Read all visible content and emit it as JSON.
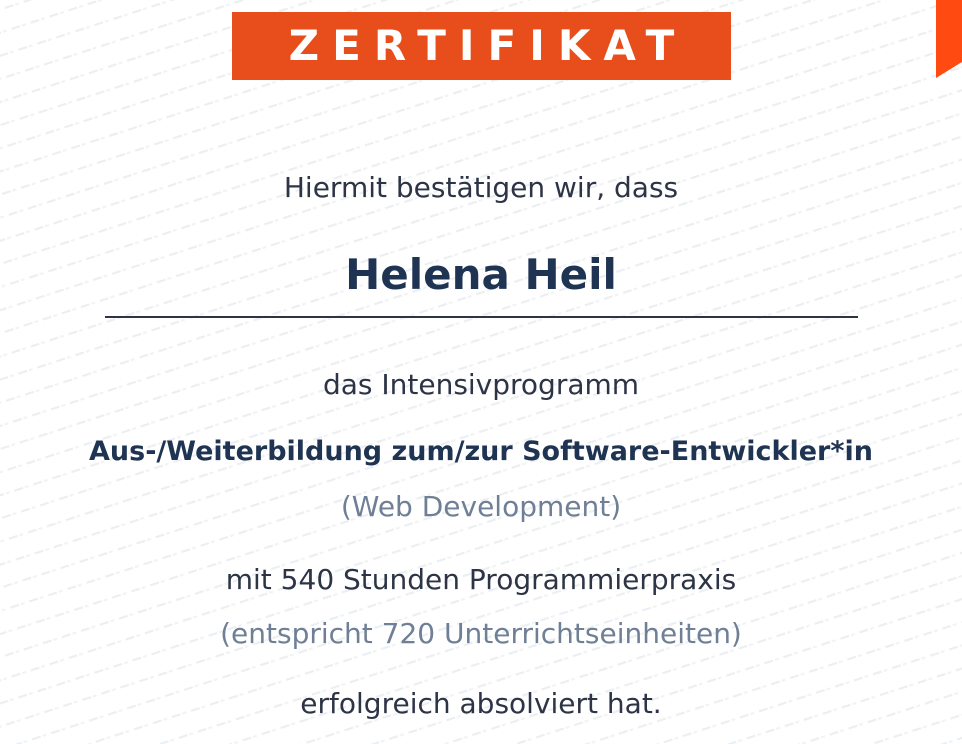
{
  "certificate": {
    "title": "ZERTIFIKAT",
    "intro": "Hiermit bestätigen wir, dass",
    "recipient_name": "Helena Heil",
    "program_intro": "das Intensivprogramm",
    "program_title": "Aus-/Weiterbildung zum/zur Software-Entwickler*in",
    "program_subtitle": "(Web Development)",
    "hours_text": "mit 540 Stunden Programmierpraxis",
    "hours_note": "(entspricht 720 Unterrichtseinheiten)",
    "closing": "erfolgreich absolviert hat."
  },
  "colors": {
    "accent": "#e84e1b",
    "corner": "#ff4a12",
    "navy": "#1f3352",
    "text": "#2c3446",
    "muted": "#6f7f95"
  }
}
